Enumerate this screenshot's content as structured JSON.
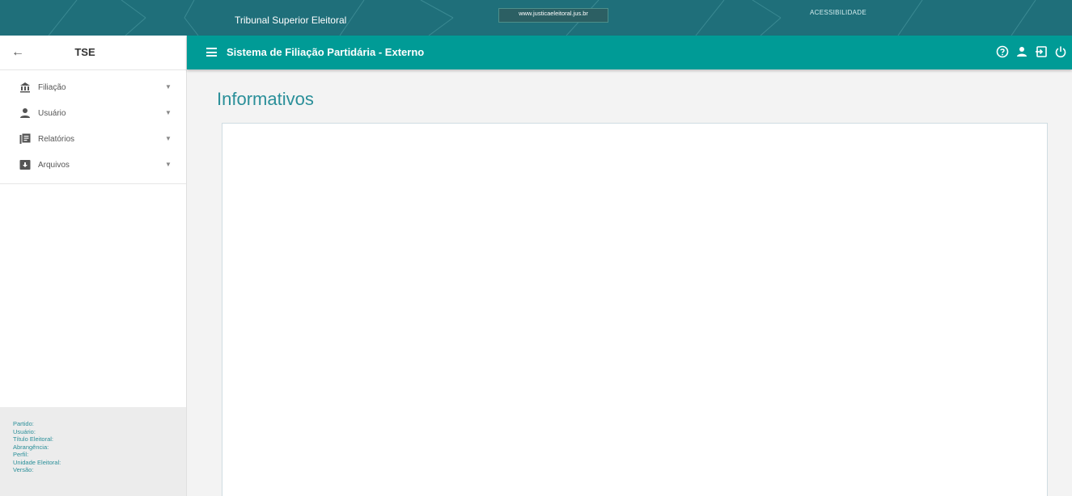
{
  "banner": {
    "title": "Tribunal Superior Eleitoral",
    "site": "www.justicaeleitoral.jus.br",
    "accessibility": "ACESSIBILIDADE"
  },
  "sidebar": {
    "title": "TSE",
    "back_icon": "arrow-left-icon",
    "items": [
      {
        "label": "Filiação",
        "icon": "bank-icon"
      },
      {
        "label": "Usuário",
        "icon": "person-icon"
      },
      {
        "label": "Relatórios",
        "icon": "report-icon"
      },
      {
        "label": "Arquivos",
        "icon": "archive-icon"
      }
    ],
    "user_info": {
      "partido": "Partido:",
      "usuario": "Usuário:",
      "titulo": "Título Eleitoral:",
      "abrangencia": "Abrangência:",
      "perfil": "Perfil:",
      "unidade": "Unidade Eleitoral:",
      "versao": "Versão:"
    }
  },
  "appbar": {
    "title": "Sistema de Filiação Partidária - Externo",
    "icons": [
      "help-icon",
      "user-icon",
      "login-icon",
      "power-icon"
    ]
  },
  "main": {
    "page_title": "Informativos"
  },
  "colors": {
    "banner": "#1f6f7a",
    "appbar": "#009b96",
    "accent_text": "#2a8f99"
  }
}
